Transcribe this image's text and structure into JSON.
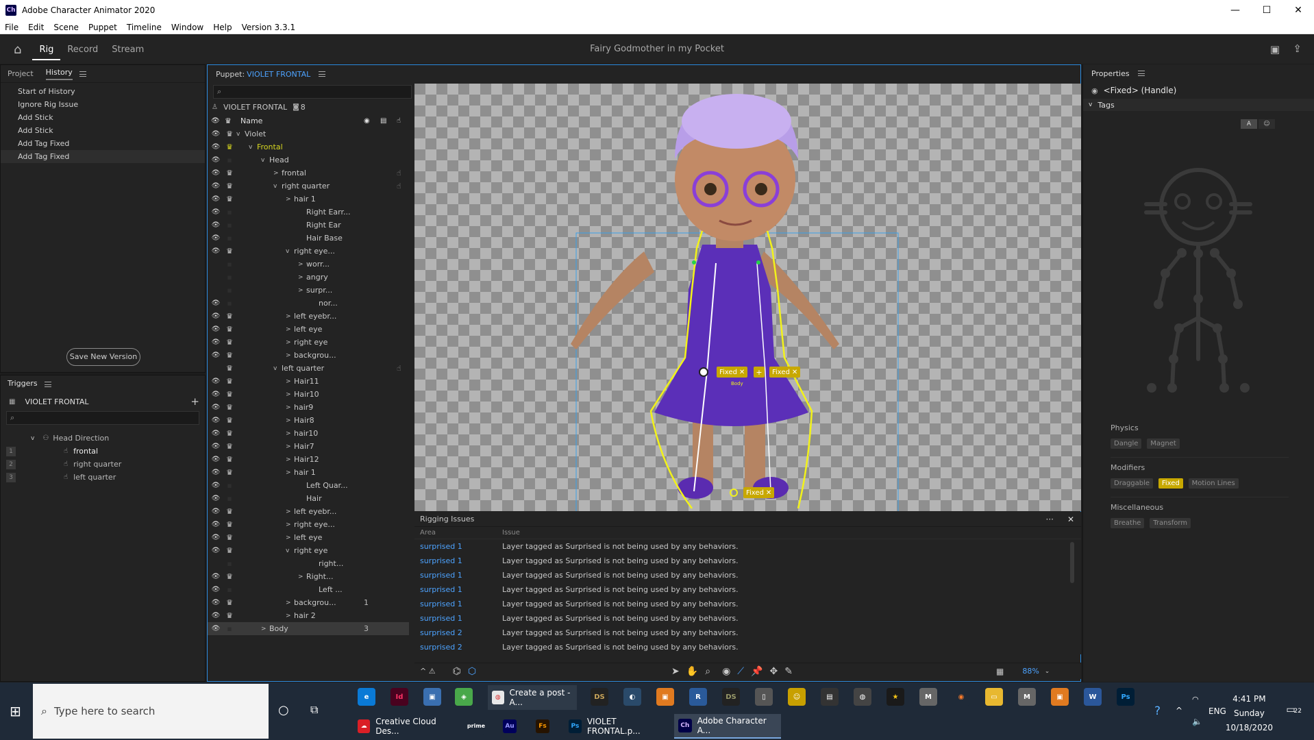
{
  "window": {
    "title": "Adobe Character Animator 2020",
    "icon": "Ch",
    "controls": [
      "—",
      "☐",
      "✕"
    ]
  },
  "menu": [
    "File",
    "Edit",
    "Scene",
    "Puppet",
    "Timeline",
    "Window",
    "Help",
    "Version 3.3.1"
  ],
  "workspace": {
    "tabs": [
      "Rig",
      "Record",
      "Stream"
    ],
    "active": "Rig",
    "doc_title": "Fairy Godmother in my Pocket"
  },
  "history": {
    "tabs": [
      "Project",
      "History"
    ],
    "items": [
      "Start of History",
      "Ignore Rig Issue",
      "Add Stick",
      "Add Stick",
      "Add Tag Fixed",
      "Add Tag Fixed"
    ],
    "save_btn": "Save New Version"
  },
  "triggers": {
    "title": "Triggers",
    "puppet": "VIOLET FRONTAL",
    "group": "Head Direction",
    "items": [
      {
        "n": "1",
        "label": "frontal"
      },
      {
        "n": "2",
        "label": "right quarter"
      },
      {
        "n": "3",
        "label": "left quarter"
      }
    ]
  },
  "puppet_panel": {
    "label": "Puppet:",
    "name": "VIOLET FRONTAL",
    "header_name": "VIOLET FRONTAL",
    "header_count": "8",
    "col_name": "Name"
  },
  "layers": [
    {
      "t": "Violet",
      "ind": 0,
      "chev": "v",
      "eye": 1,
      "crown": 1
    },
    {
      "t": "Frontal",
      "ind": 1,
      "chev": "v",
      "eye": 1,
      "crown": 1,
      "hl": 1
    },
    {
      "t": "Head",
      "ind": 2,
      "chev": "v",
      "eye": 1,
      "crown": 0
    },
    {
      "t": "frontal",
      "ind": 3,
      "chev": ">",
      "eye": 1,
      "crown": 1,
      "hand": 1
    },
    {
      "t": "right quarter",
      "ind": 3,
      "chev": "v",
      "eye": 1,
      "crown": 1,
      "hand": 1
    },
    {
      "t": "hair 1",
      "ind": 4,
      "chev": ">",
      "eye": 1,
      "crown": 1
    },
    {
      "t": "Right Earr...",
      "ind": 5,
      "chev": "",
      "eye": 1,
      "crown": 0
    },
    {
      "t": "Right  Ear",
      "ind": 5,
      "chev": "",
      "eye": 1,
      "crown": 0
    },
    {
      "t": "Hair Base",
      "ind": 5,
      "chev": "",
      "eye": 1,
      "crown": 0
    },
    {
      "t": "right eye...",
      "ind": 4,
      "chev": "v",
      "eye": 1,
      "crown": 1
    },
    {
      "t": "worr...",
      "ind": 5,
      "chev": ">",
      "eye": 0,
      "crown": 0
    },
    {
      "t": "angry",
      "ind": 5,
      "chev": ">",
      "eye": 0,
      "crown": 0
    },
    {
      "t": "surpr...",
      "ind": 5,
      "chev": ">",
      "eye": 0,
      "crown": 0
    },
    {
      "t": "nor...",
      "ind": 6,
      "chev": "",
      "eye": 1,
      "crown": 0
    },
    {
      "t": "left eyebr...",
      "ind": 4,
      "chev": ">",
      "eye": 1,
      "crown": 1
    },
    {
      "t": "left eye",
      "ind": 4,
      "chev": ">",
      "eye": 1,
      "crown": 1
    },
    {
      "t": "right eye",
      "ind": 4,
      "chev": ">",
      "eye": 1,
      "crown": 1
    },
    {
      "t": "backgrou...",
      "ind": 4,
      "chev": ">",
      "eye": 1,
      "crown": 1
    },
    {
      "t": "left quarter",
      "ind": 3,
      "chev": "v",
      "eye": 0,
      "crown": 1,
      "hand": 1
    },
    {
      "t": "Hair11",
      "ind": 4,
      "chev": ">",
      "eye": 1,
      "crown": 1
    },
    {
      "t": "Hair10",
      "ind": 4,
      "chev": ">",
      "eye": 1,
      "crown": 1
    },
    {
      "t": "hair9",
      "ind": 4,
      "chev": ">",
      "eye": 1,
      "crown": 1
    },
    {
      "t": "Hair8",
      "ind": 4,
      "chev": ">",
      "eye": 1,
      "crown": 1
    },
    {
      "t": "hair10",
      "ind": 4,
      "chev": ">",
      "eye": 1,
      "crown": 1
    },
    {
      "t": "Hair7",
      "ind": 4,
      "chev": ">",
      "eye": 1,
      "crown": 1
    },
    {
      "t": "Hair12",
      "ind": 4,
      "chev": ">",
      "eye": 1,
      "crown": 1
    },
    {
      "t": "hair 1",
      "ind": 4,
      "chev": ">",
      "eye": 1,
      "crown": 1
    },
    {
      "t": "Left Quar...",
      "ind": 5,
      "chev": "",
      "eye": 1,
      "crown": 0
    },
    {
      "t": "Hair",
      "ind": 5,
      "chev": "",
      "eye": 1,
      "crown": 0
    },
    {
      "t": "left eyebr...",
      "ind": 4,
      "chev": ">",
      "eye": 1,
      "crown": 1
    },
    {
      "t": "right eye...",
      "ind": 4,
      "chev": ">",
      "eye": 1,
      "crown": 1
    },
    {
      "t": "left eye",
      "ind": 4,
      "chev": ">",
      "eye": 1,
      "crown": 1
    },
    {
      "t": "right eye",
      "ind": 4,
      "chev": "v",
      "eye": 1,
      "crown": 1
    },
    {
      "t": "right...",
      "ind": 6,
      "chev": "",
      "eye": 0,
      "crown": 0
    },
    {
      "t": "Right...",
      "ind": 5,
      "chev": ">",
      "eye": 1,
      "crown": 1
    },
    {
      "t": "Left ...",
      "ind": 6,
      "chev": "",
      "eye": 1,
      "crown": 0
    },
    {
      "t": "backgrou...",
      "ind": 4,
      "chev": ">",
      "eye": 1,
      "crown": 1,
      "num": "1"
    },
    {
      "t": "hair 2",
      "ind": 4,
      "chev": ">",
      "eye": 1,
      "crown": 1
    },
    {
      "t": "Body",
      "ind": 2,
      "chev": ">",
      "eye": 1,
      "crown": 0,
      "num": "3",
      "body": 1
    }
  ],
  "canvas": {
    "handles": [
      "Fixed",
      "Fixed",
      "Fixed"
    ],
    "body_label": "Body"
  },
  "issues": {
    "title": "Rigging Issues",
    "col_area": "Area",
    "col_issue": "Issue",
    "rows": [
      {
        "area": "surprised 1",
        "issue": "Layer tagged as Surprised is not being used by any behaviors."
      },
      {
        "area": "surprised 1",
        "issue": "Layer tagged as Surprised is not being used by any behaviors."
      },
      {
        "area": "surprised 1",
        "issue": "Layer tagged as Surprised is not being used by any behaviors."
      },
      {
        "area": "surprised 1",
        "issue": "Layer tagged as Surprised is not being used by any behaviors."
      },
      {
        "area": "surprised 1",
        "issue": "Layer tagged as Surprised is not being used by any behaviors."
      },
      {
        "area": "surprised 1",
        "issue": "Layer tagged as Surprised is not being used by any behaviors."
      },
      {
        "area": "surprised 2",
        "issue": "Layer tagged as Surprised is not being used by any behaviors."
      },
      {
        "area": "surprised 2",
        "issue": "Layer tagged as Surprised is not being used by any behaviors."
      }
    ]
  },
  "zoom": "88%",
  "properties": {
    "title": "Properties",
    "handle": "<Fixed> (Handle)",
    "tags": "Tags",
    "physics": "Physics",
    "physics_tags": [
      "Dangle",
      "Magnet"
    ],
    "modifiers": "Modifiers",
    "modifier_tags": [
      "Draggable",
      "Fixed",
      "Motion Lines"
    ],
    "misc": "Miscellaneous",
    "misc_tags": [
      "Breathe",
      "Transform"
    ],
    "accent": "#c8a800"
  },
  "taskbar": {
    "search_placeholder": "Type here to search",
    "apps": [
      "Creative Cloud Des...",
      "Au",
      "Fs",
      "VIOLET FRONTAL.p...",
      "Adobe Character A..."
    ],
    "pinned": [
      "Create a post - A..."
    ],
    "lang": "ENG",
    "time": "4:41 PM",
    "day": "Sunday",
    "date": "10/18/2020",
    "notif": "22"
  }
}
